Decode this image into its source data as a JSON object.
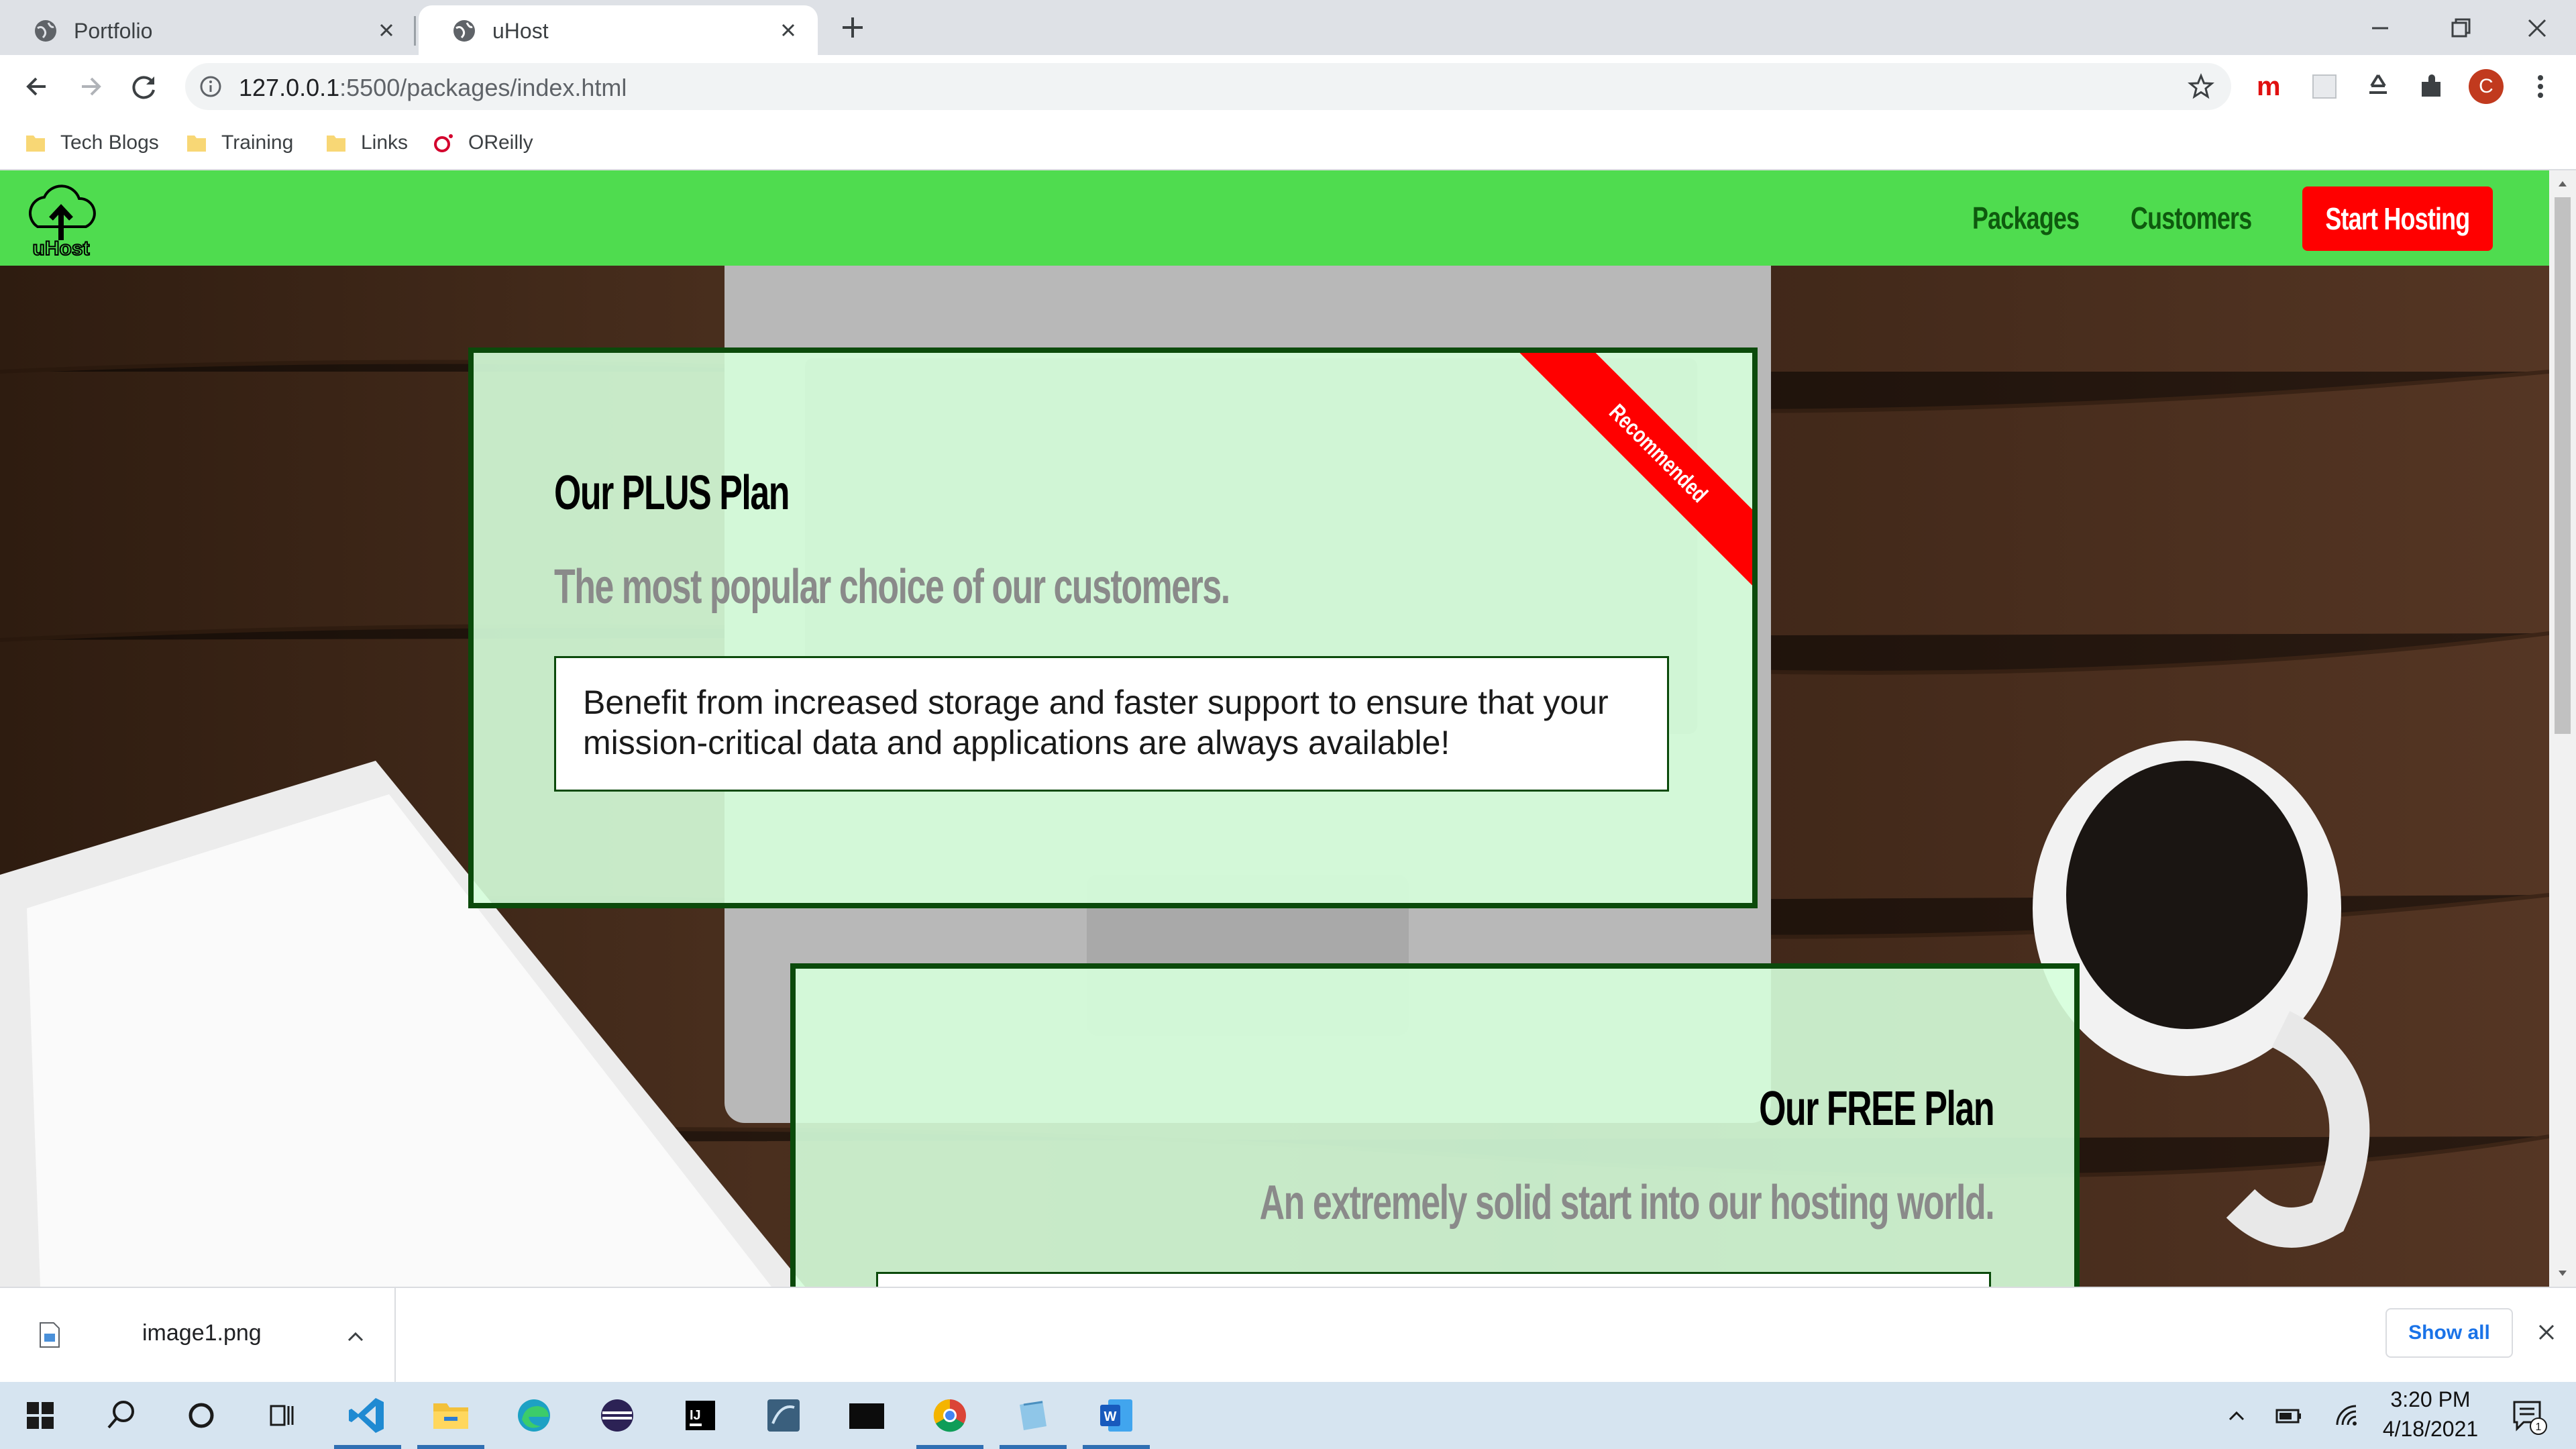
{
  "browser": {
    "tabs": [
      {
        "title": "Portfolio",
        "active": false,
        "icon": "globe-icon"
      },
      {
        "title": "uHost",
        "active": true,
        "icon": "globe-icon"
      }
    ],
    "url_host": "127.0.0.1",
    "url_rest": ":5500/packages/index.html",
    "profile_initial": "C",
    "bookmarks": [
      {
        "label": "Tech Blogs",
        "icon": "folder-icon"
      },
      {
        "label": "Training",
        "icon": "folder-icon"
      },
      {
        "label": "Links",
        "icon": "folder-icon"
      },
      {
        "label": "OReilly",
        "icon": "oreilly-icon"
      }
    ]
  },
  "site": {
    "logo_text": "uHost",
    "nav": {
      "packages": "Packages",
      "customers": "Customers",
      "cta": "Start Hosting"
    },
    "plans": [
      {
        "title": "Our PLUS Plan",
        "subtitle": "The most popular choice of our customers.",
        "description": "Benefit from increased storage and faster support to ensure that your mission-critical data and applications are always available!",
        "badge": "Recommended"
      },
      {
        "title": "Our FREE Plan",
        "subtitle": "An extremely solid start into our hosting world."
      }
    ]
  },
  "downloads": {
    "file": "image1.png",
    "show_all": "Show all"
  },
  "taskbar": {
    "time": "3:20 PM",
    "date": "4/18/2021",
    "notification_count": "1",
    "apps": [
      "vscode-icon",
      "file-explorer-icon",
      "edge-icon",
      "eclipse-icon",
      "intellij-icon",
      "mysql-workbench-icon",
      "terminal-icon",
      "chrome-icon",
      "notepad-icon",
      "word-icon"
    ]
  },
  "colors": {
    "site_green": "#4fdc4f",
    "cta_red": "#ff0000",
    "dark_green": "#0b4a0b"
  }
}
